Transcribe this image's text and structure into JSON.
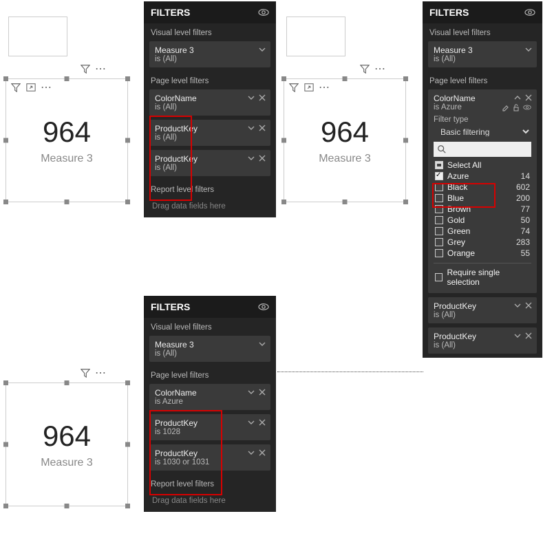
{
  "filters_title": "FILTERS",
  "section_visual": "Visual level filters",
  "section_page": "Page level filters",
  "section_report": "Report level filters",
  "drop_text": "Drag data fields here",
  "card": {
    "value": "964",
    "label": "Measure 3"
  },
  "p1": {
    "visual": {
      "name": "Measure 3",
      "sub": "is (All)"
    },
    "page": [
      {
        "name": "ColorName",
        "sub": "is (All)"
      },
      {
        "name": "ProductKey",
        "sub": "is (All)"
      },
      {
        "name": "ProductKey",
        "sub": "is (All)"
      }
    ]
  },
  "p3": {
    "visual": {
      "name": "Measure 3",
      "sub": "is (All)"
    },
    "page": [
      {
        "name": "ColorName",
        "sub": "is Azure"
      },
      {
        "name": "ProductKey",
        "sub": "is 1028"
      },
      {
        "name": "ProductKey",
        "sub": "is 1030 or 1031"
      }
    ]
  },
  "p2": {
    "visual": {
      "name": "Measure 3",
      "sub": "is (All)"
    },
    "color": {
      "name": "ColorName",
      "sub": "is Azure",
      "filter_type_label": "Filter type",
      "filter_type": "Basic filtering",
      "options": [
        {
          "label": "Select All",
          "state": "partial",
          "count": ""
        },
        {
          "label": "Azure",
          "state": "checked",
          "count": "14"
        },
        {
          "label": "Black",
          "state": "",
          "count": "602"
        },
        {
          "label": "Blue",
          "state": "",
          "count": "200"
        },
        {
          "label": "Brown",
          "state": "",
          "count": "77"
        },
        {
          "label": "Gold",
          "state": "",
          "count": "50"
        },
        {
          "label": "Green",
          "state": "",
          "count": "74"
        },
        {
          "label": "Grey",
          "state": "",
          "count": "283"
        },
        {
          "label": "Orange",
          "state": "",
          "count": "55"
        }
      ],
      "require_single": "Require single selection"
    },
    "page_rest": [
      {
        "name": "ProductKey",
        "sub": "is (All)"
      },
      {
        "name": "ProductKey",
        "sub": "is (All)"
      }
    ]
  }
}
